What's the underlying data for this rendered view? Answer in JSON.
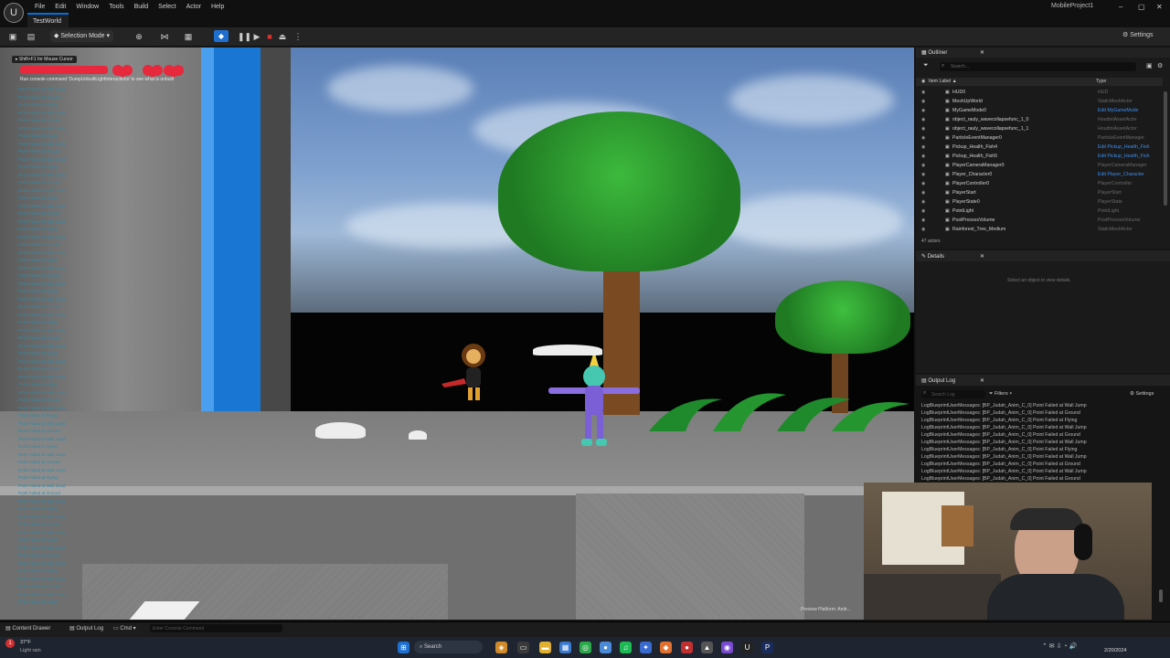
{
  "app": {
    "logo_icon": "unreal-logo-icon",
    "menu": [
      "File",
      "Edit",
      "Window",
      "Tools",
      "Build",
      "Select",
      "Actor",
      "Help"
    ],
    "level_tab": "TestWorld",
    "project_name": "MobileProject1",
    "window_controls": [
      "–",
      "▢",
      "✕"
    ]
  },
  "toolbar": {
    "mode_label": "Selection Mode",
    "settings_label": "Settings"
  },
  "viewport": {
    "mouse_hint": "Shift+F1 for Mouse Cursor",
    "console_msg": "Run console command 'DumpUnbuiltLightInteractions' to see what is unbuilt",
    "log_lines": [
      "Point Failed at Wall Jump",
      "Point Failed at Ground",
      "Point Failed at Flying",
      "Point Failed at Wall Jump",
      "Point Failed at Ground",
      "Point Failed at Wall Jump",
      "Point Failed at Flying",
      "Point Failed at Wall Jump",
      "Point Failed at Ground",
      "Point Failed at Wall Jump",
      "Point Failed at Flying",
      "Point Failed at Wall Jump",
      "Point Failed at Ground",
      "Point Failed at Wall Jump",
      "Point Failed at Flying",
      "Point Failed at Wall Jump",
      "Point Failed at Ground",
      "Point Failed at Wall Jump",
      "Point Failed at Flying",
      "Point Failed at Wall Jump",
      "Point Failed at Ground",
      "Point Failed at Wall Jump",
      "Point Failed at Flying",
      "Point Failed at Wall Jump",
      "Point Failed at Ground",
      "Point Failed at Wall Jump",
      "Point Failed at Flying",
      "Point Failed at Wall Jump",
      "Point Failed at Ground",
      "Point Failed at Wall Jump",
      "Point Failed at Flying",
      "Point Failed at Wall Jump",
      "Point Failed at Ground",
      "Point Failed at Wall Jump",
      "Point Failed at Flying",
      "Point Failed at Wall Jump",
      "Point Failed at Ground",
      "Point Failed at Wall Jump",
      "Point Failed at Flying",
      "Point Failed at Wall Jump",
      "Point Failed at Ground",
      "Point Failed at Wall Jump",
      "Point Failed at Flying",
      "Point Failed at Wall Jump",
      "Point Failed at Ground",
      "Point Failed at Wall Jump",
      "Point Failed at Flying",
      "Point Failed at Wall Jump",
      "Point Failed at Ground",
      "Point Failed at Wall Jump",
      "Point Failed at Flying",
      "Point Failed at Wall Jump",
      "Point Failed at Ground",
      "Point Failed at Wall Jump",
      "Point Failed at Flying",
      "Point Failed at Wall Jump",
      "Point Failed at Ground",
      "Point Failed at Wall Jump",
      "Point Failed at Flying",
      "Point Failed at Wall Jump",
      "Point Failed at Ground",
      "Point Failed at Wall Jump",
      "Point Failed at Flying",
      "Point Failed at Wall Jump",
      "Point Failed at Ground",
      "Point Failed at Wall Jump",
      "Point Failed at Flying"
    ],
    "preview_label": "Preview Platform: Andr...",
    "hearts_color": "#e8283c"
  },
  "outliner": {
    "tab_label": "Outliner",
    "search_placeholder": "Search...",
    "col_label": "Item Label ▲",
    "col_type": "Type",
    "rows": [
      {
        "label": "HUD0",
        "type": "HUD"
      },
      {
        "label": "MeshUpWorld",
        "type": "StaticMeshActor"
      },
      {
        "label": "MyGameMode0",
        "type": "Edit MyGameMode"
      },
      {
        "label": "object_rauly_wavecollapsefunc_1_0",
        "type": "HoudiniAssetActor"
      },
      {
        "label": "object_rauly_wavecollapsefunc_1_1",
        "type": "HoudiniAssetActor"
      },
      {
        "label": "ParticleEventManager0",
        "type": "ParticleEventManager"
      },
      {
        "label": "Pickup_Health_Fish4",
        "type": "Edit Pickup_Health_Fish"
      },
      {
        "label": "Pickup_Health_Fish5",
        "type": "Edit Pickup_Health_Fish"
      },
      {
        "label": "PlayerCameraManager0",
        "type": "PlayerCameraManager"
      },
      {
        "label": "Player_Character0",
        "type": "Edit Player_Character"
      },
      {
        "label": "PlayerController0",
        "type": "PlayerController"
      },
      {
        "label": "PlayerStart",
        "type": "PlayerStart"
      },
      {
        "label": "PlayerState0",
        "type": "PlayerState"
      },
      {
        "label": "PointLight",
        "type": "PointLight"
      },
      {
        "label": "PostProcessVolume",
        "type": "PostProcessVolume"
      },
      {
        "label": "Rainforest_Tree_Medium",
        "type": "StaticMeshActor"
      }
    ],
    "actor_count": "47 actors"
  },
  "details": {
    "tab_label": "Details",
    "empty_msg": "Select an object to view details."
  },
  "output_log": {
    "tab_label": "Output Log",
    "search_placeholder": "Search Log",
    "filters_label": "Filters",
    "settings_label": "Settings",
    "lines": [
      "LogBlueprintUserMessages: [BP_Judah_Anim_C_0] Point Failed at Wall Jump",
      "LogBlueprintUserMessages: [BP_Judah_Anim_C_0] Point Failed at Ground",
      "LogBlueprintUserMessages: [BP_Judah_Anim_C_0] Point Failed at Flying",
      "LogBlueprintUserMessages: [BP_Judah_Anim_C_0] Point Failed at Wall Jump",
      "LogBlueprintUserMessages: [BP_Judah_Anim_C_0] Point Failed at Ground",
      "LogBlueprintUserMessages: [BP_Judah_Anim_C_0] Point Failed at Wall Jump",
      "LogBlueprintUserMessages: [BP_Judah_Anim_C_0] Point Failed at Flying",
      "LogBlueprintUserMessages: [BP_Judah_Anim_C_0] Point Failed at Wall Jump",
      "LogBlueprintUserMessages: [BP_Judah_Anim_C_0] Point Failed at Ground",
      "LogBlueprintUserMessages: [BP_Judah_Anim_C_0] Point Failed at Wall Jump",
      "LogBlueprintUserMessages: [BP_Judah_Anim_C_0] Point Failed at Ground"
    ]
  },
  "statusbar": {
    "content_drawer": "Content Drawer",
    "output_log": "Output Log",
    "cmd": "Cmd",
    "console_placeholder": "Enter Console Command"
  },
  "taskbar": {
    "weather_temp": "37°F",
    "weather_desc": "Light rain",
    "search_label": "Search",
    "time": "2/20/2024"
  }
}
